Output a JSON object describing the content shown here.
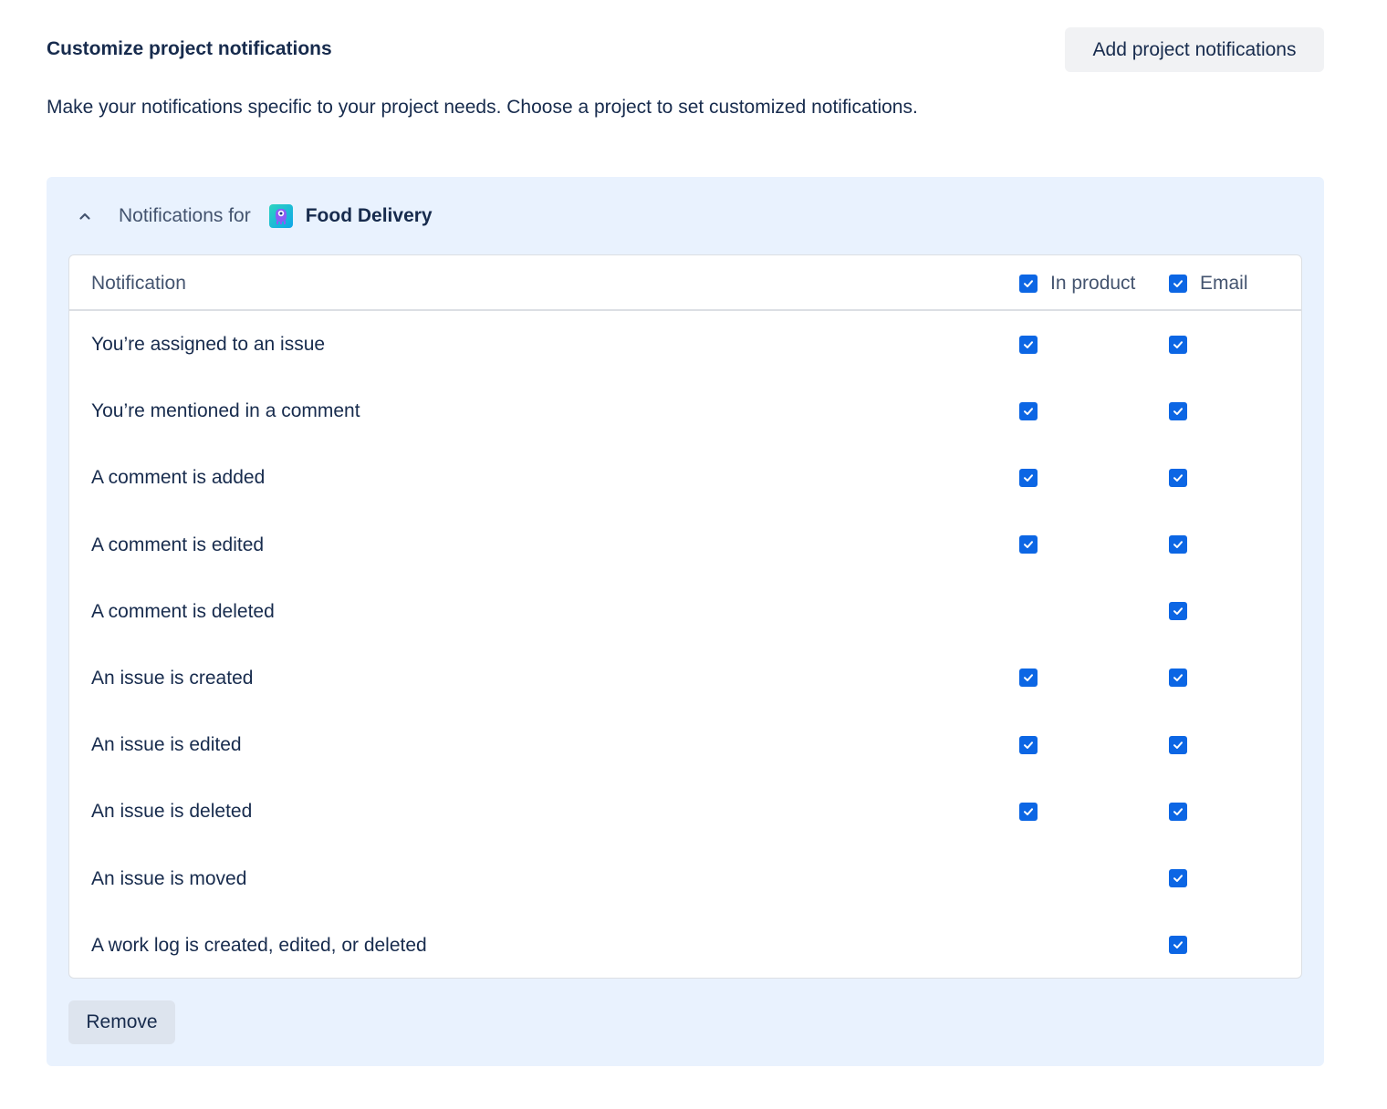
{
  "header": {
    "title": "Customize project notifications",
    "add_button_label": "Add project notifications"
  },
  "description": "Make your notifications specific to your project needs. Choose a project to set customized notifications.",
  "project_panel": {
    "expanded": true,
    "notifications_for_label": "Notifications for",
    "project_name": "Food Delivery",
    "project_icon": "project-avatar-icon",
    "table": {
      "columns": {
        "notification": "Notification",
        "in_product": "In product",
        "email": "Email"
      },
      "header_checks": {
        "in_product": true,
        "email": true
      },
      "rows": [
        {
          "label": "You’re assigned to an issue",
          "in_product": true,
          "email": true
        },
        {
          "label": "You’re mentioned in a comment",
          "in_product": true,
          "email": true
        },
        {
          "label": "A comment is added",
          "in_product": true,
          "email": true
        },
        {
          "label": "A comment is edited",
          "in_product": true,
          "email": true
        },
        {
          "label": "A comment is deleted",
          "in_product": false,
          "email": true
        },
        {
          "label": "An issue is created",
          "in_product": true,
          "email": true
        },
        {
          "label": "An issue is edited",
          "in_product": true,
          "email": true
        },
        {
          "label": "An issue is deleted",
          "in_product": true,
          "email": true
        },
        {
          "label": "An issue is moved",
          "in_product": false,
          "email": true
        },
        {
          "label": "A work log is created, edited, or deleted",
          "in_product": false,
          "email": true
        }
      ]
    },
    "remove_button_label": "Remove"
  },
  "colors": {
    "checkbox": "#0c66e4",
    "panel_background": "#e9f2fe",
    "text_primary": "#172b4d",
    "text_subtle": "#44546f"
  }
}
